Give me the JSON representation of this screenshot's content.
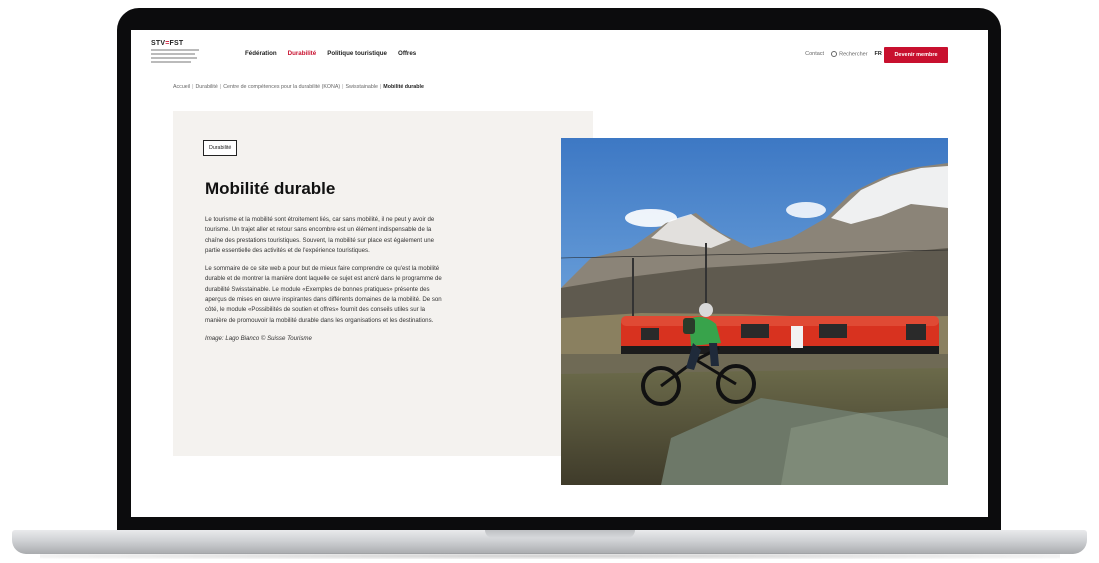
{
  "header": {
    "logo": {
      "brand": "STV",
      "brand_accent": "FST"
    },
    "nav": [
      {
        "label": "Fédération"
      },
      {
        "label": "Durabilité",
        "active": true
      },
      {
        "label": "Politique touristique"
      },
      {
        "label": "Offres"
      }
    ],
    "utility": {
      "contact": "Contact",
      "search": "Rechercher",
      "language": "FR ⌄"
    },
    "cta": "Devenir membre"
  },
  "breadcrumb": {
    "items": [
      "Accueil",
      "Durabilité",
      "Centre de compétences pour la durabilité (KONA)",
      "Swisstainable"
    ],
    "current": "Mobilité durable"
  },
  "content": {
    "tag": "Durabilité",
    "title": "Mobilité durable",
    "paragraphs": [
      "Le tourisme et la mobilité sont étroitement liés, car sans mobilité, il ne peut y avoir de tourisme. Un trajet aller et retour sans encombre est un élément indispensable de la chaîne des prestations touristiques. Souvent, la mobilité sur place est également une partie essentielle des activités et de l'expérience touristiques.",
      "Le sommaire de ce site web a pour but de mieux faire comprendre ce qu'est la mobilité durable et de montrer la manière dont laquelle ce sujet est ancré dans le programme de durabilité Swisstainable. Le module «Exemples de bonnes pratiques» présente des aperçus de mises en œuvre inspirantes dans différents domaines de la mobilité. De son côté, le module «Possibilités de soutien et offres» fournit des conseils utiles sur la manière de promouvoir la mobilité durable dans les organisations et les destinations."
    ],
    "credit": "Image: Lago Bianco © Suisse Tourisme"
  },
  "colors": {
    "brand_red": "#c8102e",
    "panel_bg": "#f4f2ef",
    "frame": "#0c0c0d"
  }
}
